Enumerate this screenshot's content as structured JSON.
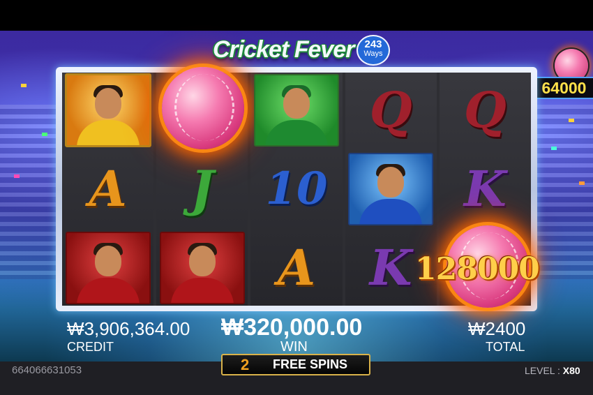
{
  "game": {
    "logo_text": "Cricket Fever",
    "ways_number": "243",
    "ways_label": "Ways"
  },
  "jackpot": {
    "value": "64000"
  },
  "reels": [
    [
      {
        "symbol": "captain-card"
      },
      {
        "symbol": "A"
      },
      {
        "symbol": "batsman-red-card"
      }
    ],
    [
      {
        "symbol": "fire-ball"
      },
      {
        "symbol": "J"
      },
      {
        "symbol": "batsman-red-card"
      }
    ],
    [
      {
        "symbol": "batsman-green-card"
      },
      {
        "symbol": "10"
      },
      {
        "symbol": "A"
      }
    ],
    [
      {
        "symbol": "Q"
      },
      {
        "symbol": "cheering-player-card"
      },
      {
        "symbol": "K"
      }
    ],
    [
      {
        "symbol": "Q"
      },
      {
        "symbol": "K"
      },
      {
        "symbol": "fire-ball"
      }
    ]
  ],
  "win_overlay": "128000",
  "credit": {
    "amount": "₩3,906,364.00",
    "label": "CREDIT"
  },
  "win": {
    "amount": "₩320,000.00",
    "label": "WIN"
  },
  "total": {
    "amount": "₩2400",
    "label": "TOTAL"
  },
  "free_spins": {
    "count": "2",
    "label": "FREE SPINS"
  },
  "session_id": "664066631053",
  "level": {
    "label": "LEVEL :",
    "value": "X80"
  },
  "colors": {
    "jackpot_text": "#ffe14a",
    "free_spin_count": "#f0a020",
    "frame_border": "#d9b24a"
  }
}
